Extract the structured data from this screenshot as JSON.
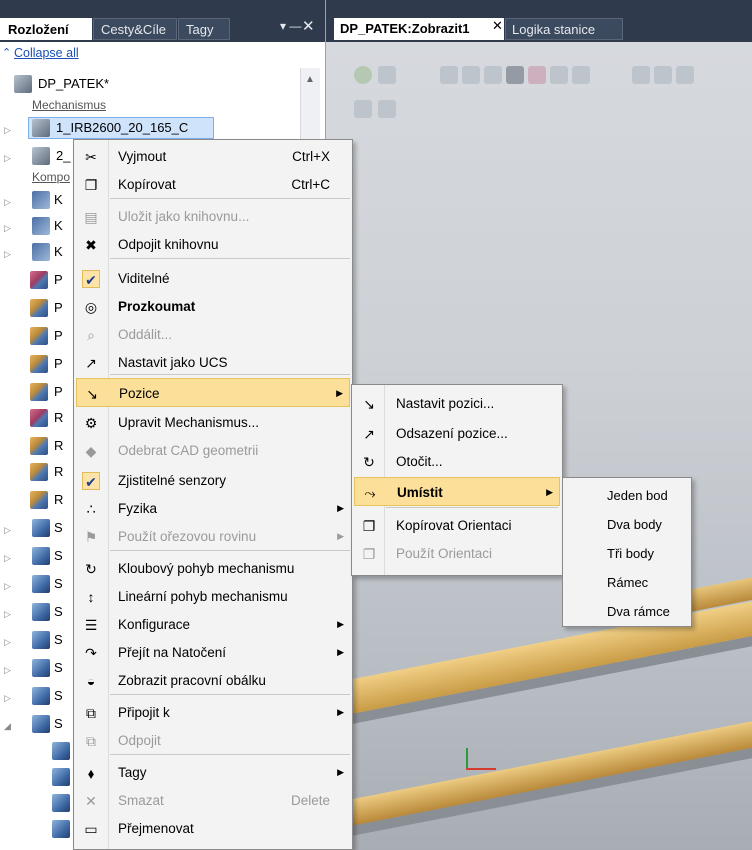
{
  "left_panel": {
    "tabs": [
      "Rozložení",
      "Cesty&Cíle",
      "Tagy"
    ],
    "pin_glyph": "▾ —",
    "close_glyph": "✕",
    "collapse_all": "Collapse all",
    "root": "DP_PATEK*",
    "group_mechanismus": "Mechanismus",
    "selected_item": "1_IRB2600_20_165_C",
    "second_item": "2_",
    "group_komponenty": "Kompo",
    "partial_rows": [
      "K",
      "K",
      "K",
      "P",
      "P",
      "P",
      "P",
      "P",
      "R",
      "R",
      "R",
      "R",
      "S",
      "S",
      "S",
      "S",
      "S",
      "S",
      "S",
      "S"
    ]
  },
  "right_area": {
    "tabs": [
      "DP_PATEK:Zobrazit1",
      "Logika stanice"
    ],
    "tab_close": "✕"
  },
  "context_menu": {
    "items": [
      {
        "label": "Vyjmout",
        "shortcut": "Ctrl+X",
        "icon": "scissors-icon",
        "glyph": "✂"
      },
      {
        "label": "Kopírovat",
        "shortcut": "Ctrl+C",
        "icon": "copy-icon",
        "glyph": "❐"
      },
      {
        "label": "Uložit jako knihovnu...",
        "disabled": true,
        "icon": "save-library-icon",
        "glyph": "▤"
      },
      {
        "label": "Odpojit knihovnu",
        "icon": "disconnect-library-icon",
        "glyph": "✖"
      },
      {
        "label": "Viditelné",
        "icon": "check-icon",
        "glyph": "✔"
      },
      {
        "label": "Prozkoumat",
        "bold": true,
        "icon": "explore-icon",
        "glyph": "◎"
      },
      {
        "label": "Oddálit...",
        "disabled": true,
        "icon": "zoom-out-icon",
        "glyph": "⌕"
      },
      {
        "label": "Nastavit jako UCS",
        "icon": "ucs-icon",
        "glyph": "↗"
      },
      {
        "label": "Pozice",
        "submenu": true,
        "icon": "position-icon",
        "glyph": "↘"
      },
      {
        "label": "Upravit Mechanismus...",
        "icon": "edit-mechanism-icon",
        "glyph": "⚙"
      },
      {
        "label": "Odebrat CAD geometrii",
        "disabled": true,
        "icon": "remove-cad-icon",
        "glyph": "◆"
      },
      {
        "label": "Zjistitelné senzory",
        "icon": "check-icon",
        "glyph": "✔"
      },
      {
        "label": "Fyzika",
        "submenu": true,
        "icon": "physics-icon",
        "glyph": "∴"
      },
      {
        "label": "Použít ořezovou rovinu",
        "disabled": true,
        "submenu": true,
        "icon": "clip-plane-icon",
        "glyph": "⚑"
      },
      {
        "label": "Kloubový pohyb mechanismu",
        "icon": "joint-jog-icon",
        "glyph": "↻"
      },
      {
        "label": "Lineární pohyb mechanismu",
        "icon": "linear-jog-icon",
        "glyph": "↕"
      },
      {
        "label": "Konfigurace",
        "submenu": true,
        "icon": "configuration-icon",
        "glyph": "☰"
      },
      {
        "label": "Přejít na Natočení",
        "submenu": true,
        "icon": "jump-to-pose-icon",
        "glyph": "↷"
      },
      {
        "label": "Zobrazit pracovní obálku",
        "icon": "work-envelope-icon",
        "glyph": "◒"
      },
      {
        "label": "Připojit k",
        "submenu": true,
        "icon": "attach-icon",
        "glyph": "⧉"
      },
      {
        "label": "Odpojit",
        "disabled": true,
        "icon": "detach-icon",
        "glyph": "⧉"
      },
      {
        "label": "Tagy",
        "submenu": true,
        "icon": "tag-icon",
        "glyph": "⬧"
      },
      {
        "label": "Smazat",
        "shortcut": "Delete",
        "disabled": true,
        "icon": "delete-icon",
        "glyph": "✕"
      },
      {
        "label": "Přejmenovat",
        "icon": "rename-icon",
        "glyph": "▭"
      }
    ]
  },
  "pozice_menu": {
    "items": [
      {
        "label": "Nastavit pozici...",
        "icon": "set-position-icon",
        "glyph": "↘"
      },
      {
        "label": "Odsazení pozice...",
        "icon": "offset-position-icon",
        "glyph": "↗"
      },
      {
        "label": "Otočit...",
        "icon": "rotate-icon",
        "glyph": "↻"
      },
      {
        "label": "Umístit",
        "submenu": true,
        "icon": "place-icon",
        "glyph": "⤳"
      },
      {
        "label": "Kopírovat Orientaci",
        "icon": "copy-orientation-icon",
        "glyph": "❐"
      },
      {
        "label": "Použít Orientaci",
        "disabled": true,
        "icon": "apply-orientation-icon",
        "glyph": "❐"
      }
    ]
  },
  "umistit_menu": {
    "items": [
      "Jeden bod",
      "Dva body",
      "Tři body",
      "Rámec",
      "Dva rámce"
    ]
  },
  "colors": {
    "highlight": "#fcdf98",
    "titlebar": "#2f3b4d",
    "beam": "#e0b866"
  }
}
